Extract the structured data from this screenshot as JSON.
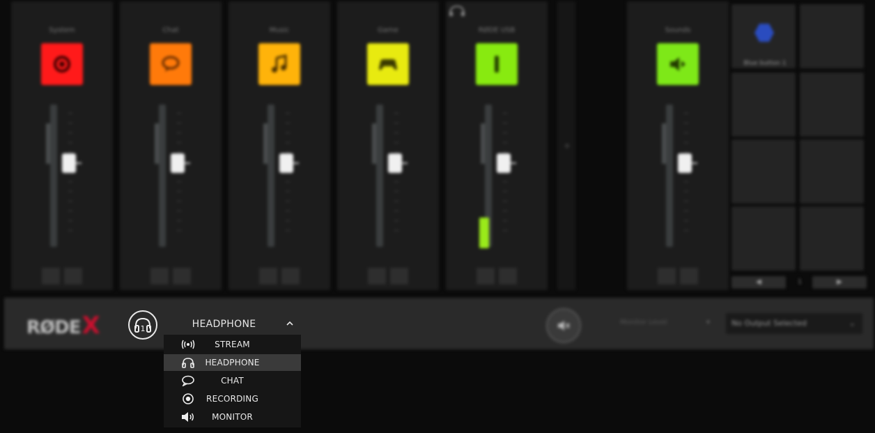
{
  "mixer": {
    "channels": [
      {
        "label": "System",
        "color": "#ff1a1a",
        "icon": "system-icon",
        "btn1": "",
        "btn2": ""
      },
      {
        "label": "Chat",
        "color": "#ff7a0a",
        "icon": "chat-icon",
        "btn1": "",
        "btn2": ""
      },
      {
        "label": "Music",
        "color": "#ffb30a",
        "icon": "music-icon",
        "btn1": "",
        "btn2": ""
      },
      {
        "label": "Game",
        "color": "#e8ea10",
        "icon": "gamepad-icon",
        "btn1": "",
        "btn2": ""
      },
      {
        "label": "RØDE USB",
        "color": "#88ea10",
        "icon": "microphone-icon",
        "btn1": "",
        "btn2": ""
      },
      {
        "label": "Sounds",
        "color": "#7ee818",
        "icon": "sounds-icon",
        "btn1": "",
        "btn2": ""
      }
    ],
    "add_symbol": "+",
    "pads": {
      "first_label": "Blue button 1",
      "prev": "◀",
      "next": "▶",
      "page": "1"
    }
  },
  "bottom_bar": {
    "logo_text": "RØDE",
    "logo_x": "X",
    "level_label": "Monitor Level",
    "output_select": "No Output Selected",
    "output_chevron": "⌄"
  },
  "mix_dropdown": {
    "selected": "HEADPHONE",
    "items": [
      {
        "label": "STREAM",
        "icon": "broadcast-icon"
      },
      {
        "label": "HEADPHONE",
        "icon": "headphone-icon"
      },
      {
        "label": "CHAT",
        "icon": "chat-bubble-icon"
      },
      {
        "label": "RECORDING",
        "icon": "record-icon"
      },
      {
        "label": "MONITOR",
        "icon": "speaker-icon"
      }
    ]
  },
  "headphone_badge": "1"
}
